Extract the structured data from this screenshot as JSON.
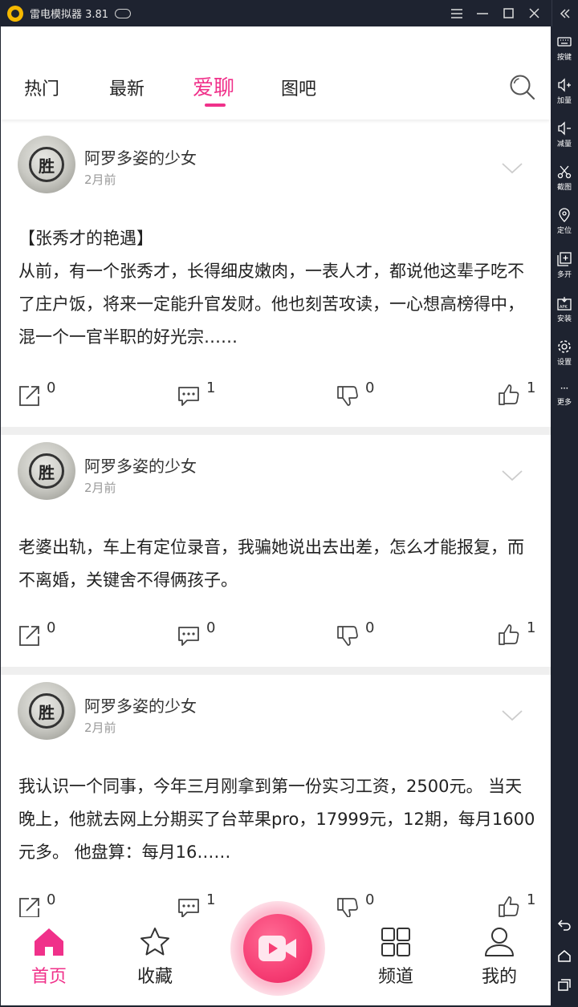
{
  "emulator": {
    "title": "雷电模拟器 3.81",
    "sidebar": [
      {
        "icon": "keyboard-icon",
        "label": "按键"
      },
      {
        "icon": "volume-up-icon",
        "label": "加量"
      },
      {
        "icon": "volume-down-icon",
        "label": "减量"
      },
      {
        "icon": "scissors-icon",
        "label": "截图"
      },
      {
        "icon": "location-pin-icon",
        "label": "定位"
      },
      {
        "icon": "multi-window-icon",
        "label": "多开"
      },
      {
        "icon": "apk-install-icon",
        "label": "安装"
      },
      {
        "icon": "gear-icon",
        "label": "设置"
      },
      {
        "icon": "more-dots-icon",
        "label": "更多"
      }
    ]
  },
  "nav": {
    "tabs": [
      "热门",
      "最新",
      "爱聊",
      "图吧"
    ],
    "active_tab": "爱聊"
  },
  "posts": [
    {
      "username": "阿罗多姿的少女",
      "time": "2月前",
      "title": "【张秀才的艳遇】",
      "text": "从前，有一个张秀才，长得细皮嫩肉，一表人才，都说他这辈子吃不了庄户饭，将来一定能升官发财。他也刻苦攻读，一心想高榜得中，混一个一官半职的好光宗……",
      "share": "0",
      "comments": "1",
      "dislikes": "0",
      "likes": "1"
    },
    {
      "username": "阿罗多姿的少女",
      "time": "2月前",
      "title": "",
      "text": "老婆出轨，车上有定位录音，我骗她说出去出差，怎么才能报复，而不离婚，关键舍不得俩孩子。",
      "share": "0",
      "comments": "0",
      "dislikes": "0",
      "likes": "1"
    },
    {
      "username": "阿罗多姿的少女",
      "time": "2月前",
      "title": "",
      "text": "我认识一个同事，今年三月刚拿到第一份实习工资，2500元。 当天晚上，他就去网上分期买了台苹果pro，17999元，12期，每月1600元多。 他盘算：每月16……",
      "share": "0",
      "comments": "1",
      "dislikes": "0",
      "likes": "1"
    }
  ],
  "avatar_glyph": "胜",
  "bottom_nav": {
    "home": "首页",
    "favorites": "收藏",
    "channels": "频道",
    "mine": "我的"
  },
  "colors": {
    "accent": "#f0318a",
    "video_button": "#f63e74"
  }
}
